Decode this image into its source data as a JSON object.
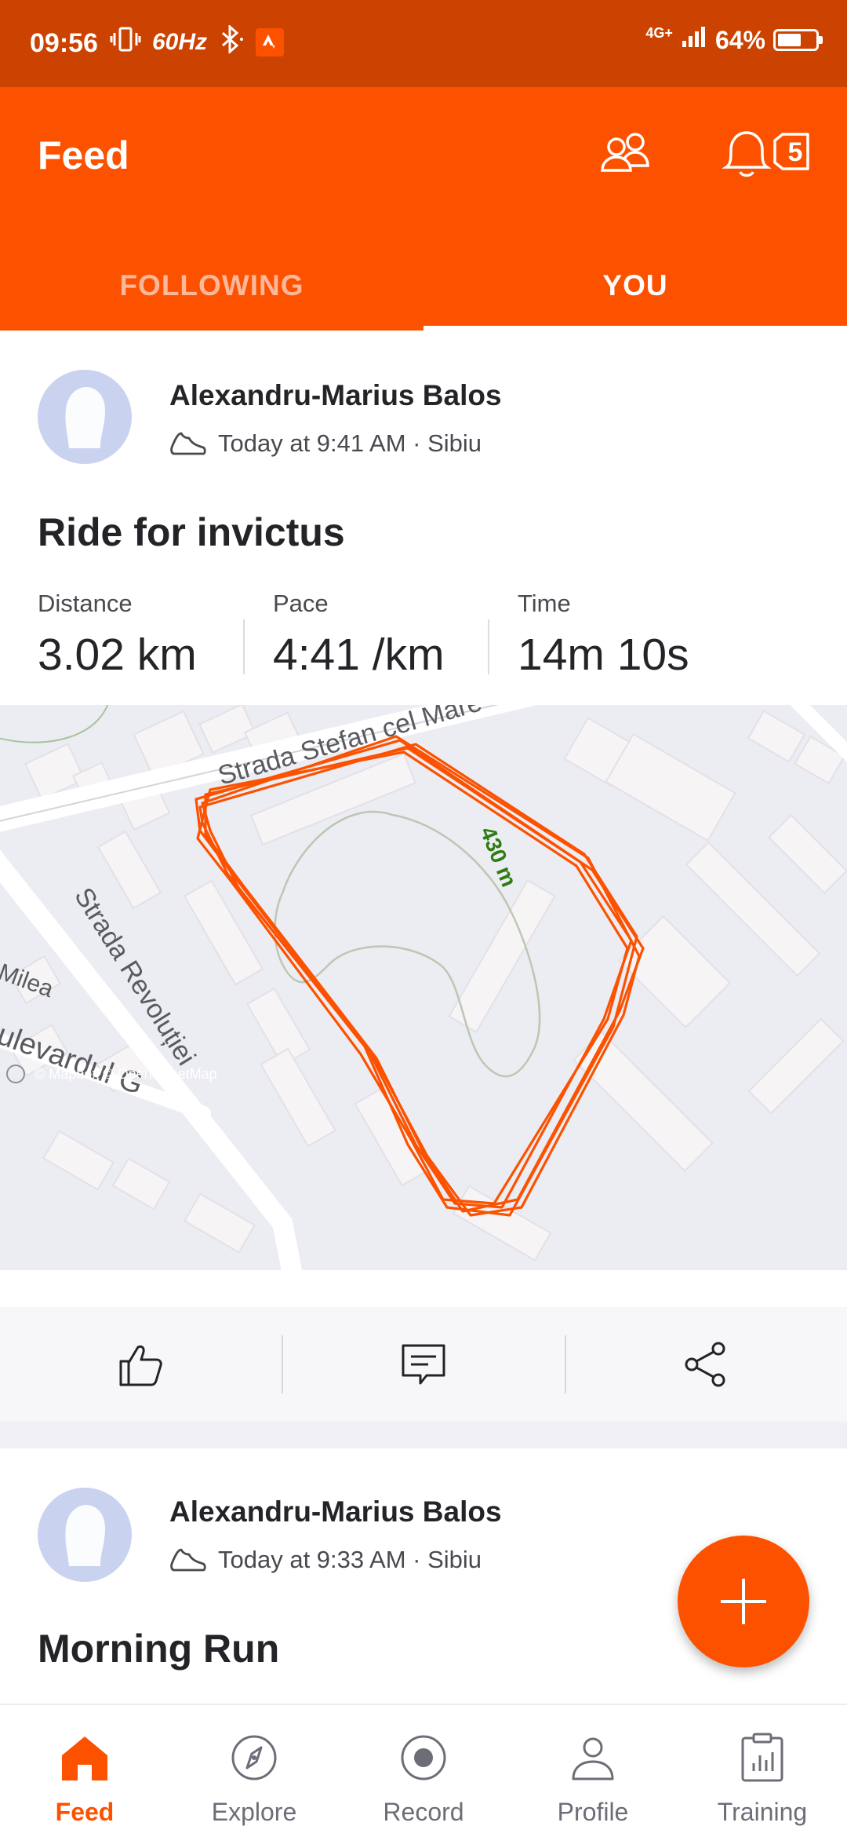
{
  "status_bar": {
    "time": "09:56",
    "refresh_rate": "60Hz",
    "network": "4G+",
    "battery": "64%",
    "battery_level": 0.64
  },
  "header": {
    "title": "Feed",
    "notification_count": "5",
    "tabs": [
      {
        "label": "FOLLOWING",
        "active": false
      },
      {
        "label": "YOU",
        "active": true
      }
    ]
  },
  "activities": [
    {
      "athlete": "Alexandru-Marius Balos",
      "meta": "Today at 9:41 AM · Sibiu",
      "title": "Ride for invictus",
      "stats": [
        {
          "label": "Distance",
          "value": "3.02 km"
        },
        {
          "label": "Pace",
          "value": "4:41 /km"
        },
        {
          "label": "Time",
          "value": "14m 10s"
        }
      ],
      "map": {
        "street_labels": [
          "Strada Stefan cel Mare",
          "Strada Revoluției",
          "Milea",
          "ulevardul G"
        ],
        "segment_label": "430 m",
        "attribution": "© Mapbox © OpenStreetMap"
      }
    },
    {
      "athlete": "Alexandru-Marius Balos",
      "meta": "Today at 9:33 AM · Sibiu",
      "title": "Morning Run"
    }
  ],
  "bottom_nav": [
    {
      "label": "Feed",
      "icon": "home-icon",
      "active": true
    },
    {
      "label": "Explore",
      "icon": "compass-icon",
      "active": false
    },
    {
      "label": "Record",
      "icon": "record-icon",
      "active": false
    },
    {
      "label": "Profile",
      "icon": "person-icon",
      "active": false
    },
    {
      "label": "Training",
      "icon": "clipboard-chart-icon",
      "active": false
    }
  ],
  "colors": {
    "brand": "#fc5200",
    "status_bar": "#cc4200",
    "route": "#fc5200",
    "segment": "#2e7d10"
  }
}
